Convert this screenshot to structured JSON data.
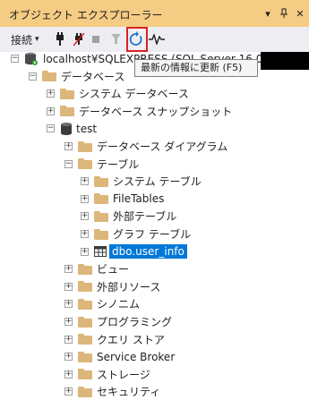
{
  "window": {
    "title": "オブジェクト エクスプローラー"
  },
  "toolbar": {
    "connect_label": "接続",
    "tooltip": "最新の情報に更新 (F5)"
  },
  "tree": {
    "server": "localhost¥SQLEXPRESS (SQL Server 16.0.1115",
    "databases": "データベース",
    "system_databases": "システム データベース",
    "snapshots": "データベース スナップショット",
    "db_name": "test",
    "diagrams": "データベース ダイアグラム",
    "tables": "テーブル",
    "system_tables": "システム テーブル",
    "filetables": "FileTables",
    "external_tables": "外部テーブル",
    "graph_tables": "グラフ テーブル",
    "selected_table": "dbo.user_info",
    "views": "ビュー",
    "external_resources": "外部リソース",
    "synonyms": "シノニム",
    "programmability": "プログラミング",
    "query_store": "クエリ ストア",
    "service_broker": "Service Broker",
    "storage": "ストレージ",
    "security": "セキュリティ"
  },
  "colors": {
    "titlebar": "#f5cc84",
    "toolbar": "#eeeef2",
    "selection": "#0078d7",
    "highlight_box": "#e01f1f",
    "folder": "#dcb67a"
  }
}
